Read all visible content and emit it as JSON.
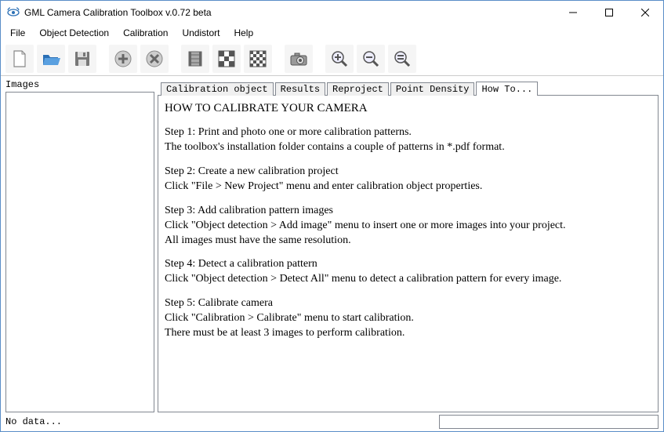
{
  "window": {
    "title": "GML Camera Calibration Toolbox  v.0.72 beta"
  },
  "menu": {
    "items": [
      "File",
      "Object Detection",
      "Calibration",
      "Undistort",
      "Help"
    ]
  },
  "toolbar": {
    "buttons": [
      {
        "name": "new-file-icon"
      },
      {
        "name": "open-folder-icon"
      },
      {
        "name": "save-icon"
      },
      {
        "sep": true
      },
      {
        "name": "add-icon"
      },
      {
        "name": "remove-icon"
      },
      {
        "sep": true
      },
      {
        "name": "film-icon"
      },
      {
        "name": "checker-large-icon"
      },
      {
        "name": "checker-small-icon"
      },
      {
        "sep": true
      },
      {
        "name": "camera-icon"
      },
      {
        "sep": true
      },
      {
        "name": "zoom-in-icon"
      },
      {
        "name": "zoom-out-icon"
      },
      {
        "name": "zoom-fit-icon"
      }
    ]
  },
  "leftPanel": {
    "label": "Images"
  },
  "tabs": {
    "items": [
      {
        "label": "Calibration object",
        "active": false
      },
      {
        "label": "Results",
        "active": false
      },
      {
        "label": "Reproject",
        "active": false
      },
      {
        "label": "Point Density",
        "active": false
      },
      {
        "label": "How To...",
        "active": true
      }
    ]
  },
  "howto": {
    "heading": "HOW TO CALIBRATE YOUR CAMERA",
    "step1": "Step 1: Print and photo one or more calibration patterns.\nThe toolbox's installation folder contains a couple of patterns in *.pdf format.",
    "step2": "Step 2: Create a new calibration project\nClick  \"File > New Project\"  menu and enter calibration object properties.",
    "step3": "Step 3: Add calibration pattern images\nClick  \"Object detection > Add image\"  menu to insert one or more images into your project.\nAll images must have the same resolution.",
    "step4": "Step 4: Detect a calibration pattern\nClick  \"Object detection > Detect All\"  menu to detect a calibration pattern for every image.",
    "step5": "Step 5: Calibrate camera\nClick  \"Calibration > Calibrate\"  menu to start calibration.\nThere must be at least 3 images to perform calibration."
  },
  "status": {
    "text": "No data..."
  }
}
